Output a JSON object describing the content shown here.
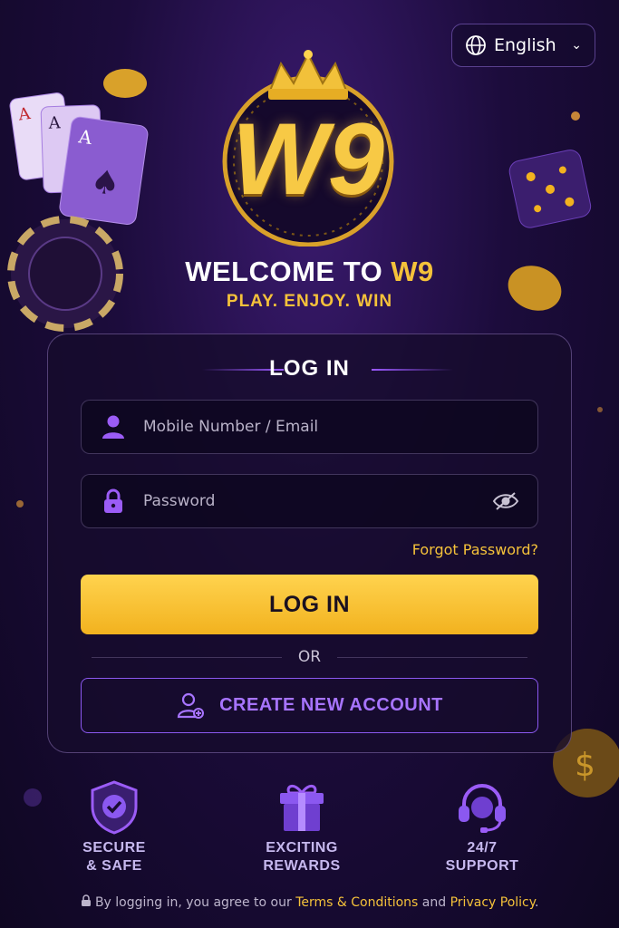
{
  "language": {
    "selected": "English",
    "icon": "globe-icon"
  },
  "brand": {
    "logo_text": "W9",
    "welcome_prefix": "WELCOME TO ",
    "welcome_accent": "W9",
    "tagline": "PLAY. ENJOY. WIN"
  },
  "login": {
    "title": "LOG IN",
    "username_placeholder": "Mobile Number / Email",
    "password_placeholder": "Password",
    "forgot_label": "Forgot Password?",
    "submit_label": "LOG IN",
    "or_label": "OR",
    "create_label": "CREATE NEW ACCOUNT"
  },
  "features": [
    {
      "label": "SECURE\n& SAFE",
      "icon": "shield-check-icon"
    },
    {
      "label": "EXCITING\nREWARDS",
      "icon": "gift-icon"
    },
    {
      "label": "24/7\nSUPPORT",
      "icon": "headset-icon"
    }
  ],
  "footer": {
    "prefix": "By logging in, you agree to our ",
    "terms": "Terms & Conditions",
    "and": " and ",
    "privacy": "Privacy Policy",
    "suffix": "."
  },
  "colors": {
    "accent": "#f5c23a",
    "purple": "#8b58f0",
    "background": "#1c0c3c"
  }
}
